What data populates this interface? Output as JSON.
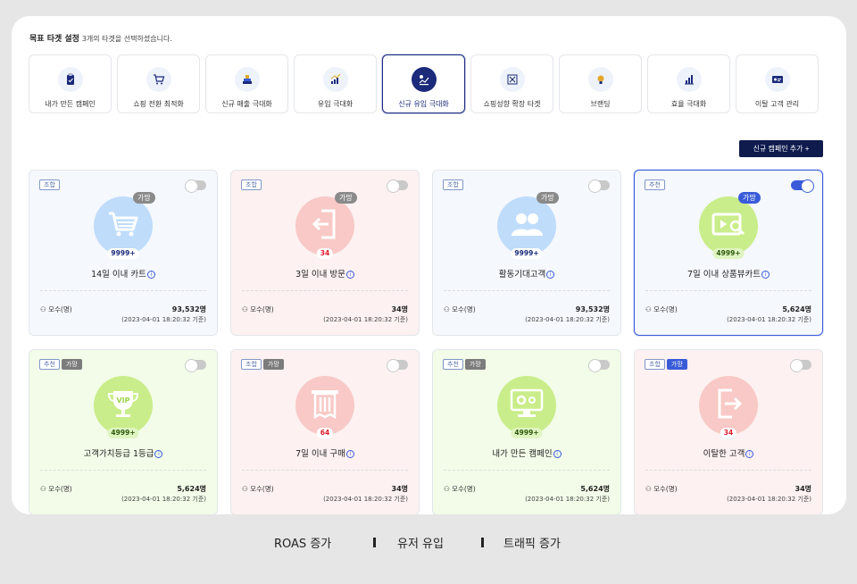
{
  "header": {
    "title": "목표 타겟 설정",
    "subtitle": "3개의 타겟을 선택하셨습니다."
  },
  "tabs": [
    {
      "label": "내가 만든 캠페인",
      "icon": "clipboard-check-icon",
      "active": false
    },
    {
      "label": "쇼핑 전환 최적화",
      "icon": "shopping-cart-icon",
      "active": false
    },
    {
      "label": "신규 매출 극대화",
      "icon": "coin-stack-icon",
      "active": false
    },
    {
      "label": "유입 극대화",
      "icon": "chart-up-icon",
      "active": false
    },
    {
      "label": "신규 유입 극대화",
      "icon": "growth-badge-icon",
      "active": true
    },
    {
      "label": "쇼핑성향 확장 타겟",
      "icon": "expand-icon",
      "active": false
    },
    {
      "label": "브랜딩",
      "icon": "lightbulb-icon",
      "active": false
    },
    {
      "label": "효율 극대화",
      "icon": "bar-chart-icon",
      "active": false
    },
    {
      "label": "이탈 고객 관리",
      "icon": "id-card-icon",
      "active": false
    }
  ],
  "add_campaign_label": "신규 캠페인 추가 +",
  "cards": [
    {
      "tags": [
        "조합"
      ],
      "grade": "가망",
      "count": "9999+",
      "name": "14일 이내 카트",
      "pop_label": "모수(명)",
      "pop_value": "93,532명",
      "timestamp": "(2023-04-01 18:20:32 기준)",
      "toggle": false,
      "icon": "shopping-cart-icon"
    },
    {
      "tags": [
        "조합"
      ],
      "grade": "가망",
      "count": "34",
      "name": "3일 이내 방문",
      "pop_label": "모수(명)",
      "pop_value": "34명",
      "timestamp": "(2023-04-01 18:20:32 기준)",
      "toggle": false,
      "icon": "login-door-icon"
    },
    {
      "tags": [
        "조합"
      ],
      "grade": "가망",
      "count": "9999+",
      "name": "활동기대고객",
      "pop_label": "모수(명)",
      "pop_value": "93,532명",
      "timestamp": "(2023-04-01 18:20:32 기준)",
      "toggle": false,
      "icon": "users-icon"
    },
    {
      "tags": [
        "추천"
      ],
      "grade": "가망",
      "count": "4999+",
      "name": "7일 이내 상품뷰카트",
      "pop_label": "모수(명)",
      "pop_value": "5,624명",
      "timestamp": "(2023-04-01 18:20:32 기준)",
      "toggle": true,
      "icon": "product-view-icon"
    },
    {
      "tags": [
        "추천",
        "가망"
      ],
      "grade": "",
      "count": "4999+",
      "name": "고객가치등급 1등급",
      "pop_label": "모수(명)",
      "pop_value": "5,624명",
      "timestamp": "(2023-04-01 18:20:32 기준)",
      "toggle": false,
      "icon": "vip-trophy-icon"
    },
    {
      "tags": [
        "조합",
        "가망"
      ],
      "grade": "",
      "count": "64",
      "name": "7일 이내 구매",
      "pop_label": "모수(명)",
      "pop_value": "34명",
      "timestamp": "(2023-04-01 18:20:32 기준)",
      "toggle": false,
      "icon": "receipt-icon"
    },
    {
      "tags": [
        "추천",
        "가망"
      ],
      "grade": "",
      "count": "4999+",
      "name": "내가 만든 캠페인",
      "pop_label": "모수(명)",
      "pop_value": "5,624명",
      "timestamp": "(2023-04-01 18:20:32 기준)",
      "toggle": false,
      "icon": "monitor-gear-icon"
    },
    {
      "tags": [
        "조합",
        "가망"
      ],
      "grade": "",
      "count": "34",
      "name": "이탈한 고객",
      "pop_label": "모수(명)",
      "pop_value": "34명",
      "timestamp": "(2023-04-01 18:20:32 기준)",
      "toggle": false,
      "icon": "logout-door-icon"
    }
  ],
  "bottom_nav": [
    "ROAS 증가",
    "유저 유입",
    "트래픽 증가"
  ],
  "colors": {
    "primary": "#1b2a7a",
    "accent": "#3a5bd9",
    "add_button": "#0f1a4d",
    "alert_red": "#e0202b"
  }
}
